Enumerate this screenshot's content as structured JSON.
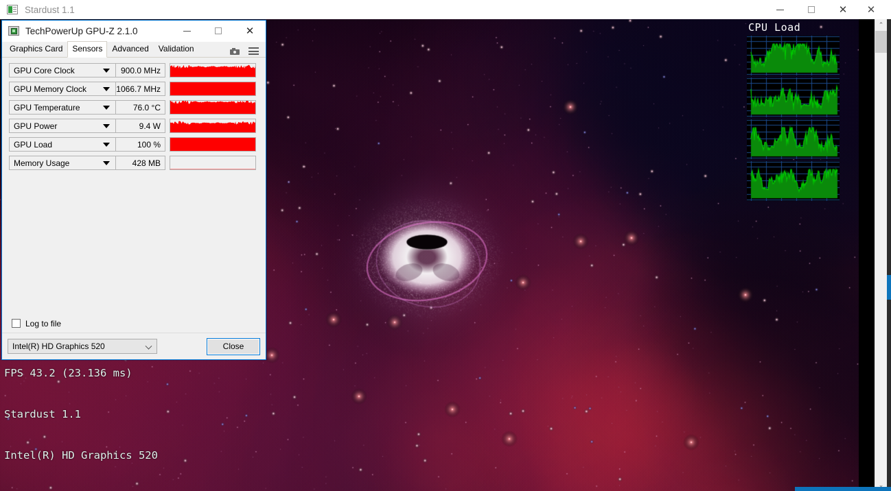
{
  "outer_window": {
    "close_label": "✕"
  },
  "stardust_window": {
    "title": "Stardust 1.1",
    "icon": "app-icon",
    "buttons": {
      "minimize": "—",
      "maximize": "▢",
      "close": "✕"
    },
    "overlay": {
      "line1": "FPS 43.2 (23.136 ms)",
      "line2": "Stardust 1.1",
      "line3": "Intel(R) HD Graphics 520",
      "color": "#dff0ea"
    }
  },
  "cpu_widget": {
    "title": "CPU  Load",
    "graph_color": "#00c800",
    "grid_color": "#1b4b8f",
    "graph_count": 4
  },
  "gpuz": {
    "title": "TechPowerUp GPU-Z 2.1.0",
    "icon": "gpu-chip-icon",
    "window_buttons": {
      "minimize": "—",
      "maximize": "▢",
      "close": "✕"
    },
    "tabs": [
      {
        "label": "Graphics Card",
        "active": false
      },
      {
        "label": "Sensors",
        "active": true
      },
      {
        "label": "Advanced",
        "active": false
      },
      {
        "label": "Validation",
        "active": false
      }
    ],
    "tab_icons": {
      "camera": "camera-icon",
      "menu": "hamburger-menu-icon"
    },
    "sensors": [
      {
        "name": "GPU Core Clock",
        "value": "900.0 MHz",
        "fill": 0.78,
        "noisy": true,
        "graph_color": "#fe0000"
      },
      {
        "name": "GPU Memory Clock",
        "value": "1066.7 MHz",
        "fill": 1.0,
        "noisy": false,
        "graph_color": "#fe0000"
      },
      {
        "name": "GPU Temperature",
        "value": "76.0 °C",
        "fill": 0.92,
        "noisy": true,
        "graph_color": "#fe0000"
      },
      {
        "name": "GPU Power",
        "value": "9.4 W",
        "fill": 0.72,
        "noisy": true,
        "graph_color": "#fe0000"
      },
      {
        "name": "GPU Load",
        "value": "100 %",
        "fill": 1.0,
        "noisy": false,
        "graph_color": "#fe0000"
      },
      {
        "name": "Memory Usage",
        "value": "428 MB",
        "fill": 0.05,
        "noisy": false,
        "graph_color": "#fe8080"
      }
    ],
    "log_to_file": {
      "label": "Log to file",
      "checked": false
    },
    "gpu_select": {
      "value": "Intel(R) HD Graphics 520"
    },
    "close_button": {
      "label": "Close"
    },
    "accent_color": "#0078d7"
  },
  "scrollbar": {
    "up_arrow": "⌃",
    "down_arrow": "⌄",
    "accent_color": "#0d74bb"
  }
}
